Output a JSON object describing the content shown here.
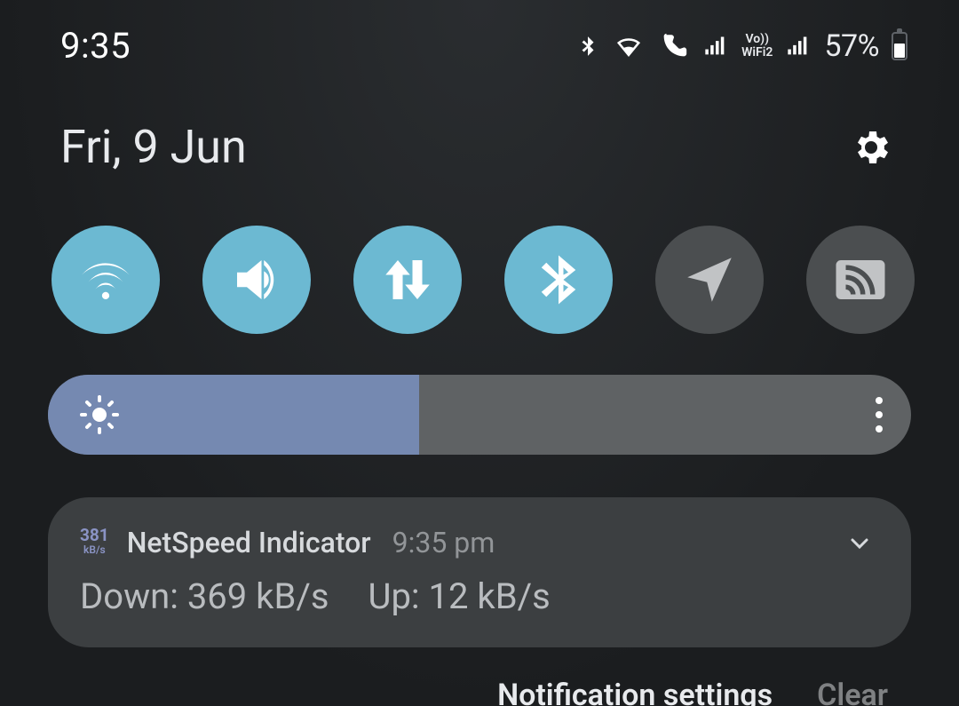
{
  "status": {
    "time": "9:35",
    "sim_label": "Vo))\nWiFi2",
    "battery_text": "57%"
  },
  "header": {
    "date": "Fri, 9 Jun"
  },
  "toggles": [
    {
      "name": "wifi",
      "active": true
    },
    {
      "name": "sound",
      "active": true
    },
    {
      "name": "mobiledata",
      "active": true
    },
    {
      "name": "bluetooth",
      "active": true
    },
    {
      "name": "location",
      "active": false
    },
    {
      "name": "smartview",
      "active": false
    }
  ],
  "brightness": {
    "percent": 43
  },
  "notification": {
    "icon_value": "381",
    "icon_unit": "kB/s",
    "app": "NetSpeed Indicator",
    "time": "9:35 pm",
    "down_label": "Down: 369 kB/s",
    "up_label": "Up: 12 kB/s"
  },
  "footer": {
    "settings": "Notification settings",
    "clear": "Clear"
  }
}
